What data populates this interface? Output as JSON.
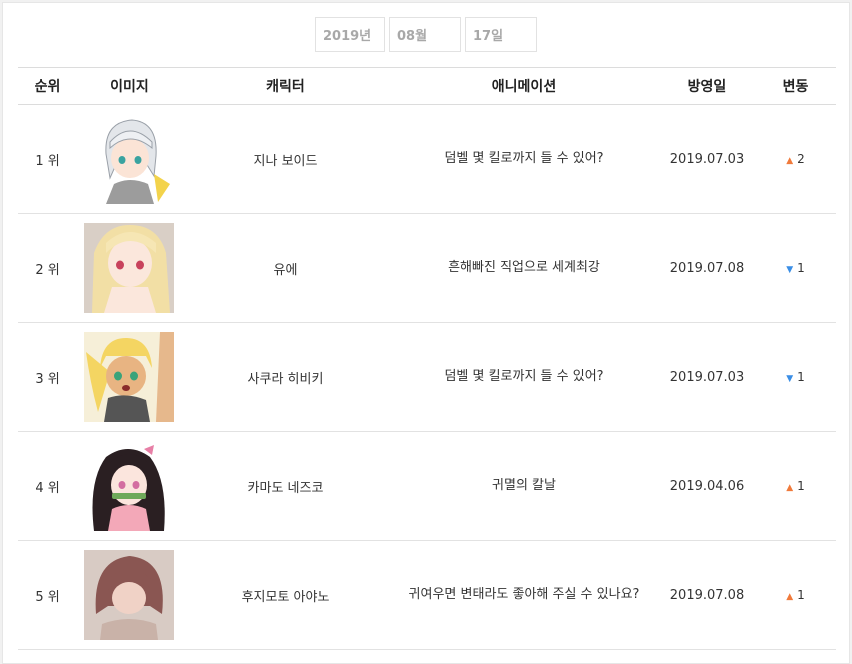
{
  "date_picker": {
    "year": "2019년",
    "month": "08월",
    "day": "17일"
  },
  "table": {
    "headers": {
      "rank": "순위",
      "image": "이미지",
      "character": "캐릭터",
      "animation": "애니메이션",
      "air_date": "방영일",
      "change": "변동"
    },
    "rows": [
      {
        "rank": "1 위",
        "character": "지나 보이드",
        "animation": "덤벨 몇 킬로까지 들 수 있어?",
        "air_date": "2019.07.03",
        "direction": "up",
        "change": "2",
        "image_icon": "character-portrait-silver-hair"
      },
      {
        "rank": "2 위",
        "character": "유에",
        "animation": "흔해빠진 직업으로 세계최강",
        "air_date": "2019.07.08",
        "direction": "down",
        "change": "1",
        "image_icon": "character-portrait-blonde-long-hair"
      },
      {
        "rank": "3 위",
        "character": "사쿠라 히비키",
        "animation": "덤벨 몇 킬로까지 들 수 있어?",
        "air_date": "2019.07.03",
        "direction": "down",
        "change": "1",
        "image_icon": "character-portrait-blonde-twintails"
      },
      {
        "rank": "4 위",
        "character": "카마도 네즈코",
        "animation": "귀멸의 칼날",
        "air_date": "2019.04.06",
        "direction": "up",
        "change": "1",
        "image_icon": "character-portrait-dark-hair-bamboo"
      },
      {
        "rank": "5 위",
        "character": "후지모토 아야노",
        "animation": "귀여우면 변태라도 좋아해 주실 수 있나요?",
        "air_date": "2019.07.08",
        "direction": "up",
        "change": "1",
        "image_icon": "character-portrait-brown-bob"
      }
    ]
  },
  "colors": {
    "up_arrow": "#f07a3b",
    "down_arrow": "#3a8ee6"
  }
}
